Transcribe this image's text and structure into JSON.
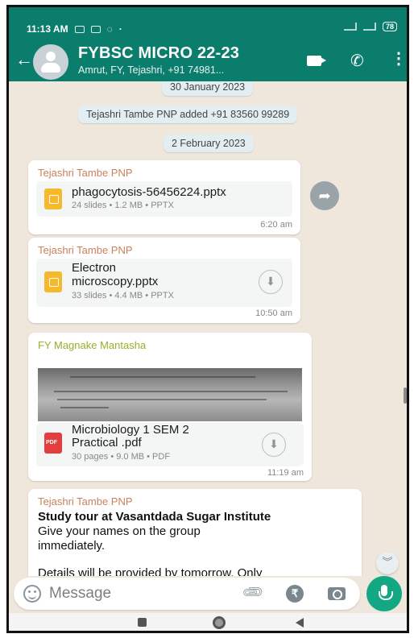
{
  "status_bar": {
    "time": "11:13 AM",
    "battery": "78"
  },
  "header": {
    "title": "FYBSC MICRO 22-23",
    "subtitle": "Amrut, FY, Tejashri, +91 74981..."
  },
  "chips": [
    "30 January 2023",
    "Tejashri Tambe PNP added +91 83560 99289",
    "2 February 2023"
  ],
  "messages": [
    {
      "sender": "Tejashri Tambe PNP",
      "file_name": "phagocytosis-56456224.pptx",
      "file_meta": "24 slides • 1.2 MB • PPTX",
      "time": "6:20 am"
    },
    {
      "sender": "Tejashri Tambe PNP",
      "file_name_line1": "Electron",
      "file_name_line2": "microscopy.pptx",
      "file_meta": "33 slides • 4.4 MB • PPTX",
      "time": "10:50 am"
    },
    {
      "sender": "FY Magnake Mantasha",
      "file_name_line1": "Microbiology 1 SEM 2",
      "file_name_line2": "Practical .pdf",
      "file_meta": "30 pages • 9.0 MB • PDF",
      "file_icon_label": "PDF",
      "time": "11:19 am"
    },
    {
      "sender": "Tejashri Tambe PNP",
      "bold": "Study tour at Vasantdada  Sugar Institute",
      "line1": "Give your names on the group",
      "line2": "immediately.",
      "line3": "Details will be provided by tomorrow. Only"
    }
  ],
  "input": {
    "placeholder": "Message"
  },
  "colors": {
    "header": "#0b7d6c",
    "accent": "#12a884",
    "chat_bg": "#efe7dc"
  },
  "icons": [
    "back-arrow-icon",
    "group-avatar-icon",
    "video-call-icon",
    "phone-icon",
    "more-menu-icon",
    "share-icon",
    "download-icon",
    "emoji-icon",
    "attach-icon",
    "rupee-icon",
    "camera-icon",
    "mic-icon",
    "scroll-down-icon"
  ]
}
